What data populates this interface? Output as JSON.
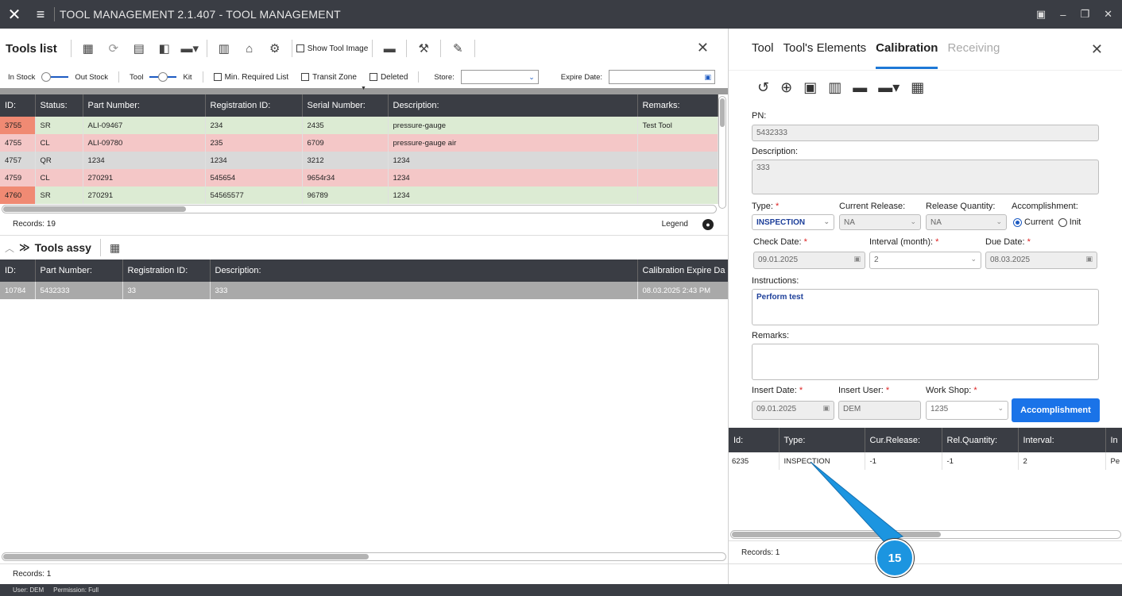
{
  "window": {
    "title": "TOOL MANAGEMENT 2.1.407 - TOOL MANAGEMENT"
  },
  "tools_list": {
    "heading": "Tools list",
    "show_tool_image": "Show Tool Image",
    "in_stock": "In Stock",
    "out_stock": "Out Stock",
    "tool": "Tool",
    "kit": "Kit",
    "min_required": "Min. Required List",
    "transit_zone": "Transit Zone",
    "deleted": "Deleted",
    "store_label": "Store:",
    "expire_label": "Expire Date:",
    "columns": [
      "ID:",
      "Status:",
      "Part Number:",
      "Registration ID:",
      "Serial Number:",
      "Description:",
      "Remarks:"
    ],
    "rows": [
      {
        "id": "3755",
        "status": "SR",
        "pn": "ALI-09467",
        "reg": "234",
        "sn": "2435",
        "desc": "pressure-gauge",
        "rem": "Test Tool"
      },
      {
        "id": "4755",
        "status": "CL",
        "pn": "ALI-09780",
        "reg": "235",
        "sn": "6709",
        "desc": "pressure-gauge air",
        "rem": ""
      },
      {
        "id": "4757",
        "status": "QR",
        "pn": "1234",
        "reg": "1234",
        "sn": "3212",
        "desc": "1234",
        "rem": ""
      },
      {
        "id": "4759",
        "status": "CL",
        "pn": "270291",
        "reg": "545654",
        "sn": "9654r34",
        "desc": "1234",
        "rem": ""
      },
      {
        "id": "4760",
        "status": "SR",
        "pn": "270291",
        "reg": "54565577",
        "sn": "96789",
        "desc": "1234",
        "rem": ""
      }
    ],
    "records": "Records: 19",
    "legend": "Legend"
  },
  "tools_assy": {
    "heading": "Tools assy",
    "columns": [
      "ID:",
      "Part Number:",
      "Registration ID:",
      "Description:",
      "Calibration Expire Da"
    ],
    "rows": [
      {
        "id": "10784",
        "pn": "5432333",
        "reg": "33",
        "desc": "333",
        "exp": "08.03.2025 2:43 PM"
      }
    ],
    "records": "Records: 1"
  },
  "status": {
    "user": "User: DEM",
    "permission": "Permission: Full"
  },
  "right": {
    "tabs": [
      "Tool",
      "Tool's Elements",
      "Calibration",
      "Receiving"
    ],
    "pn_label": "PN:",
    "pn_value": "5432333",
    "desc_label": "Description:",
    "desc_value": "333",
    "type_label": "Type:",
    "type_value": "INSPECTION",
    "cur_release_label": "Current Release:",
    "cur_release_value": "NA",
    "rel_qty_label": "Release Quantity:",
    "rel_qty_value": "NA",
    "accomplishment_label": "Accomplishment:",
    "acc_current": "Current",
    "acc_init": "Init",
    "check_date_label": "Check Date:",
    "check_date_value": "09.01.2025",
    "interval_label": "Interval (month):",
    "interval_value": "2",
    "due_date_label": "Due Date:",
    "due_date_value": "08.03.2025",
    "instructions_label": "Instructions:",
    "instructions_value": "Perform test",
    "remarks_label": "Remarks:",
    "insert_date_label": "Insert Date:",
    "insert_date_value": "09.01.2025",
    "insert_user_label": "Insert User:",
    "insert_user_value": "DEM",
    "workshop_label": "Work Shop:",
    "workshop_value": "1235",
    "accomplishment_button": "Accomplishment",
    "cal_columns": [
      "Id:",
      "Type:",
      "Cur.Release:",
      "Rel.Quantity:",
      "Interval:",
      "In"
    ],
    "cal_rows": [
      {
        "id": "6235",
        "type": "INSPECTION",
        "cur": "-1",
        "rel": "-1",
        "interval": "2",
        "in": "Pe"
      }
    ],
    "records": "Records: 1"
  },
  "callout": {
    "number": "15"
  }
}
